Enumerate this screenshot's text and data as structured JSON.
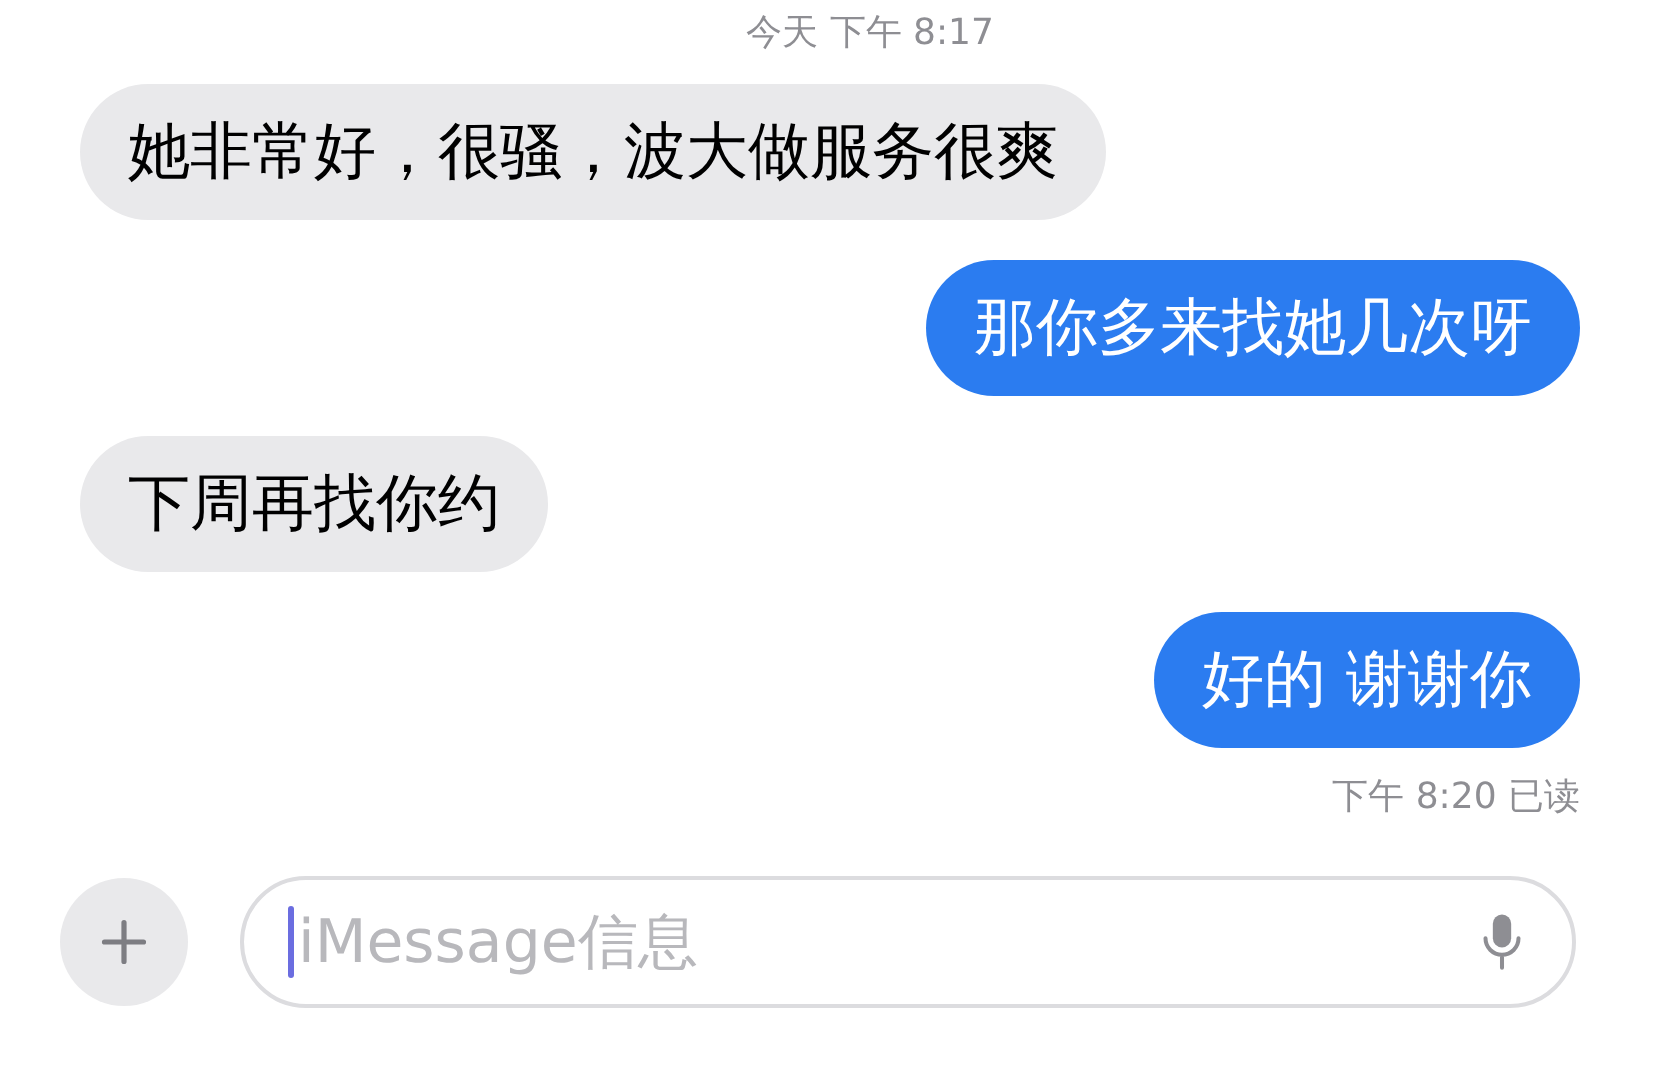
{
  "timestamp": "今天 下午 8:17",
  "messages": [
    {
      "text": "她非常好，很骚，波大做服务很爽",
      "kind": "incoming"
    },
    {
      "text": "那你多来找她几次呀",
      "kind": "outgoing"
    },
    {
      "text": "下周再找你约",
      "kind": "incoming"
    },
    {
      "text": "好的 谢谢你",
      "kind": "outgoing"
    }
  ],
  "receipt": "下午 8:20 已读",
  "composer": {
    "placeholder": "iMessage信息"
  }
}
